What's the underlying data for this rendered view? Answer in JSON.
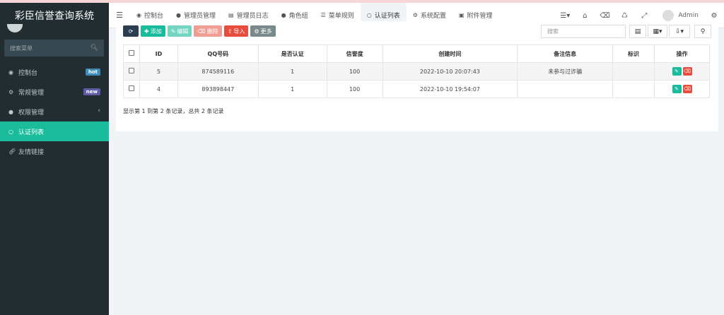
{
  "app": {
    "title": "彩臣信誉查询系统"
  },
  "sidebar": {
    "search_placeholder": "搜索菜单",
    "items": [
      {
        "label": "控制台",
        "badge": "hot",
        "icon": "dashboard-icon"
      },
      {
        "label": "常规管理",
        "badge": "new",
        "icon": "cogs-icon"
      },
      {
        "label": "权限管理",
        "badge": "",
        "icon": "group-icon"
      },
      {
        "label": "认证列表",
        "badge": "",
        "icon": "circle-icon",
        "active": true
      },
      {
        "label": "友情链接",
        "badge": "",
        "icon": "link-icon"
      }
    ]
  },
  "topnav": {
    "tabs": [
      {
        "label": "控制台"
      },
      {
        "label": "管理员管理"
      },
      {
        "label": "管理员日志"
      },
      {
        "label": "角色组"
      },
      {
        "label": "菜单规则"
      },
      {
        "label": "认证列表",
        "active": true
      },
      {
        "label": "系统配置"
      },
      {
        "label": "附件管理"
      }
    ],
    "user": "Admin"
  },
  "toolbar": {
    "add": "添加",
    "edit": "编辑",
    "delete": "删除",
    "import": "导入",
    "more": "更多",
    "search_placeholder": "搜索"
  },
  "table": {
    "headers": [
      "ID",
      "QQ号码",
      "是否认证",
      "信誉度",
      "创建时间",
      "备注信息",
      "标识",
      "操作"
    ],
    "rows": [
      {
        "id": "5",
        "qq": "874589116",
        "verified": "1",
        "credit": "100",
        "created": "2022-10-10 20:07:43",
        "remark": "未参与过诈骗",
        "tag": ""
      },
      {
        "id": "4",
        "qq": "893898447",
        "verified": "1",
        "credit": "100",
        "created": "2022-10-10 19:54:07",
        "remark": "",
        "tag": ""
      }
    ]
  },
  "pagination": {
    "info": "显示第 1 到第 2 条记录，总共 2 条记录"
  },
  "colors": {
    "sidebar": "#222d32",
    "accent": "#1abc9c",
    "danger": "#e74c3c",
    "primary_dark": "#2c3e50"
  }
}
